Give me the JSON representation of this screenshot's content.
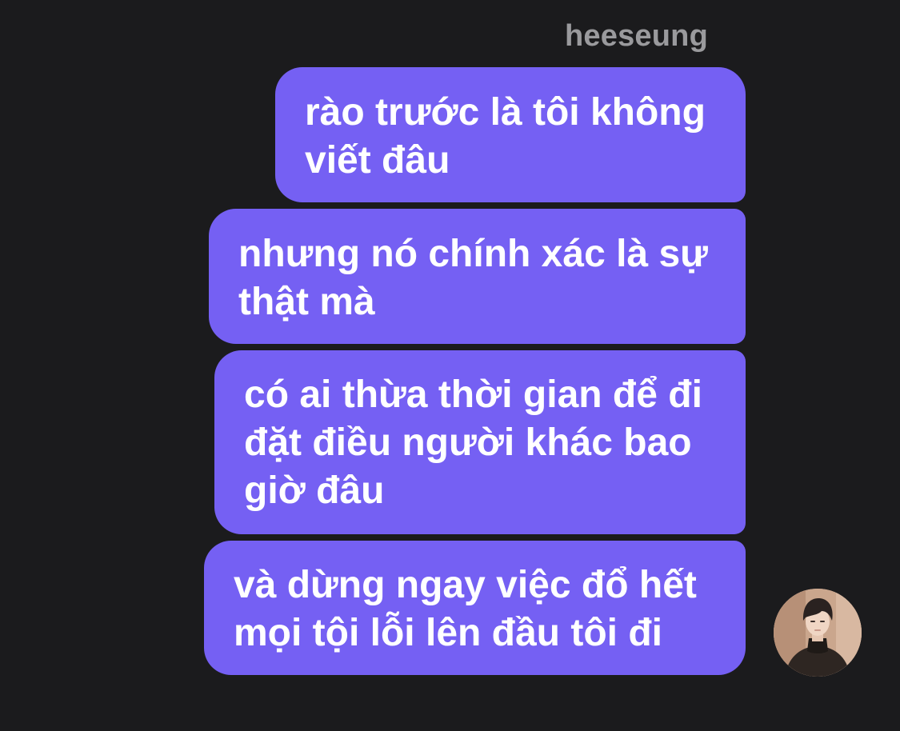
{
  "conversation": {
    "sender_name": "heeseung",
    "messages": [
      {
        "lines": [
          "rào trước là tôi không",
          "viết đâu"
        ]
      },
      {
        "lines": [
          "nhưng nó chính xác là sự",
          "thật mà"
        ]
      },
      {
        "lines": [
          "có ai thừa thời gian để đi",
          "đặt điều người khác bao",
          "giờ đâu"
        ]
      },
      {
        "lines": [
          "và dừng ngay việc đổ hết",
          "mọi tội lỗi lên đầu tôi đi"
        ]
      }
    ]
  },
  "colors": {
    "background": "#1b1b1d",
    "bubble": "#7560f3",
    "message_text": "#ffffff",
    "sender_text": "#9a9a9d"
  },
  "avatar": {
    "icon": "user-avatar-photo"
  }
}
